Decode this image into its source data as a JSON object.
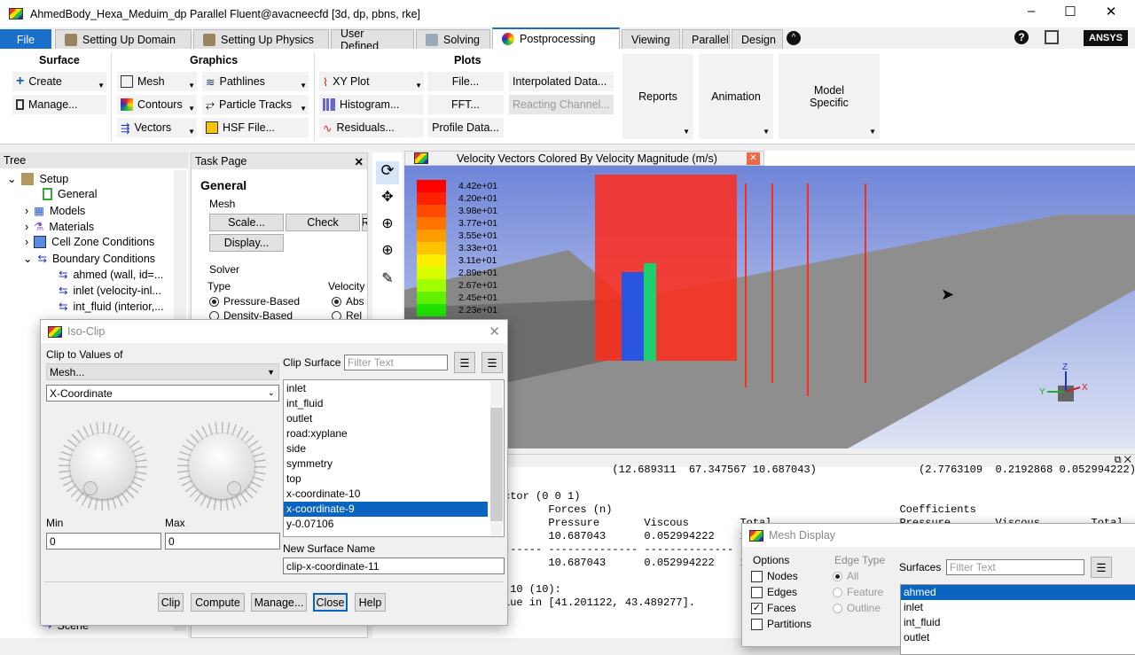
{
  "window": {
    "title": "AhmedBody_Hexa_Meduim_dp Parallel Fluent@avacneecfd  [3d, dp, pbns, rke]",
    "minimize": "–",
    "maximize": "☐",
    "close": "✕"
  },
  "tabs": [
    {
      "label": "File"
    },
    {
      "label": "Setting Up Domain"
    },
    {
      "label": "Setting Up Physics"
    },
    {
      "label": "User Defined"
    },
    {
      "label": "Solving"
    },
    {
      "label": "Postprocessing"
    },
    {
      "label": "Viewing"
    },
    {
      "label": "Parallel"
    },
    {
      "label": "Design"
    }
  ],
  "brand": "ANSYS",
  "ribbon": {
    "surface": {
      "title": "Surface",
      "create": "Create",
      "manage": "Manage..."
    },
    "graphics": {
      "title": "Graphics",
      "mesh": "Mesh",
      "contours": "Contours",
      "vectors": "Vectors",
      "pathlines": "Pathlines",
      "particle_tracks": "Particle Tracks",
      "hsf_file": "HSF File..."
    },
    "plots": {
      "title": "Plots",
      "xy_plot": "XY Plot",
      "histogram": "Histogram...",
      "residuals": "Residuals...",
      "file": "File...",
      "fft": "FFT...",
      "profile_data": "Profile Data...",
      "interpolated": "Interpolated Data...",
      "reacting": "Reacting Channel..."
    },
    "reports": "Reports",
    "animation": "Animation",
    "model_specific": "Model Specific"
  },
  "tree": {
    "title": "Tree",
    "items": [
      {
        "label": "Setup"
      },
      {
        "label": "General"
      },
      {
        "label": "Models"
      },
      {
        "label": "Materials"
      },
      {
        "label": "Cell Zone Conditions"
      },
      {
        "label": "Boundary Conditions"
      },
      {
        "label": "ahmed (wall, id=..."
      },
      {
        "label": "inlet (velocity-inl..."
      },
      {
        "label": "int_fluid (interior,..."
      },
      {
        "label": "Scene"
      }
    ]
  },
  "task_page": {
    "title": "Task Page",
    "heading": "General",
    "mesh_group": "Mesh",
    "scale": "Scale...",
    "check": "Check",
    "report_partial": "R",
    "display": "Display...",
    "solver_group": "Solver",
    "type_label": "Type",
    "velocity_label": "Velocity",
    "pressure_based": "Pressure-Based",
    "density_based": "Density-Based",
    "absolute": "Abs",
    "relative": "Rel"
  },
  "graphics": {
    "title": "Velocity Vectors Colored By Velocity Magnitude (m/s)",
    "legend": [
      "4.42e+01",
      "4.20e+01",
      "3.98e+01",
      "3.77e+01",
      "3.55e+01",
      "3.33e+01",
      "3.11e+01",
      "2.89e+01",
      "2.67e+01",
      "2.45e+01",
      "2.23e+01"
    ],
    "legend_colors": [
      "#ff0000",
      "#ff2200",
      "#ff4a00",
      "#ff7300",
      "#ff9c00",
      "#ffc400",
      "#ffee00",
      "#d8ff00",
      "#a0ff00",
      "#60f000",
      "#20e000"
    ],
    "axes": {
      "x": "X",
      "y": "Y",
      "z": "Z"
    }
  },
  "console": {
    "lines": [
      "                 (12.689311  67.347567 10.687043)                (2.7763109  0.2192868 0.052994222)",
      "",
      "ctor (0 0 1)",
      "       Forces (n)                                             Coefficients",
      "       Pressure       Viscous        Total                    Pressure       Viscous        Total",
      "       10.687043      0.052994222    1",
      "------ -------------- -------------- -",
      "       10.687043      0.052994222    1",
      "",
      "-10 (10):",
      "lue in [41.201122, 43.489277]."
    ]
  },
  "iso_clip": {
    "title": "Iso-Clip",
    "clip_to_values_of": "Clip to Values of",
    "category": "Mesh...",
    "field": "X-Coordinate",
    "min_label": "Min",
    "max_label": "Max",
    "min": "0",
    "max": "0",
    "clip_surface": "Clip Surface",
    "filter_placeholder": "Filter Text",
    "surfaces": [
      "inlet",
      "int_fluid",
      "outlet",
      "road:xyplane",
      "side",
      "symmetry",
      "top",
      "x-coordinate-10",
      "x-coordinate-9",
      "y-0.07106"
    ],
    "selected": "x-coordinate-9",
    "new_surface_name_label": "New Surface Name",
    "new_surface_name": "clip-x-coordinate-11",
    "buttons": {
      "clip": "Clip",
      "compute": "Compute",
      "manage": "Manage...",
      "close": "Close",
      "help": "Help"
    }
  },
  "mesh_display": {
    "title": "Mesh Display",
    "options": "Options",
    "nodes": "Nodes",
    "edges": "Edges",
    "faces": "Faces",
    "partitions": "Partitions",
    "edge_type": "Edge Type",
    "all": "All",
    "feature": "Feature",
    "outline": "Outline",
    "surfaces_label": "Surfaces",
    "filter_placeholder": "Filter Text",
    "surfaces": [
      "ahmed",
      "inlet",
      "int_fluid",
      "outlet"
    ],
    "faces_checked": true
  }
}
